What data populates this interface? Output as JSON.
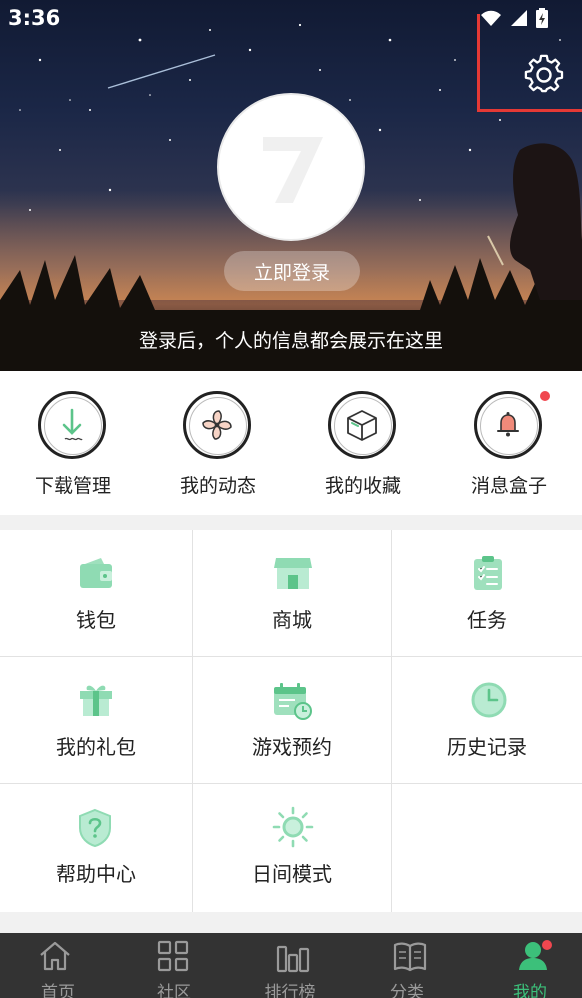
{
  "status_bar": {
    "time": "3:36"
  },
  "profile": {
    "login_button": "立即登录",
    "login_hint": "登录后，个人的信息都会展示在这里"
  },
  "quick_actions": [
    {
      "label": "下载管理",
      "icon": "download-icon"
    },
    {
      "label": "我的动态",
      "icon": "fan-icon"
    },
    {
      "label": "我的收藏",
      "icon": "box-icon"
    },
    {
      "label": "消息盒子",
      "icon": "bell-icon",
      "has_badge": true
    }
  ],
  "menu": [
    {
      "label": "钱包",
      "icon": "wallet-icon"
    },
    {
      "label": "商城",
      "icon": "store-icon"
    },
    {
      "label": "任务",
      "icon": "task-list-icon"
    },
    {
      "label": "我的礼包",
      "icon": "gift-icon"
    },
    {
      "label": "游戏预约",
      "icon": "calendar-icon"
    },
    {
      "label": "历史记录",
      "icon": "clock-icon"
    },
    {
      "label": "帮助中心",
      "icon": "help-shield-icon"
    },
    {
      "label": "日间模式",
      "icon": "sun-icon"
    }
  ],
  "tabbar": [
    {
      "label": "首页",
      "icon": "home-icon"
    },
    {
      "label": "社区",
      "icon": "grid-icon"
    },
    {
      "label": "排行榜",
      "icon": "ranking-icon"
    },
    {
      "label": "分类",
      "icon": "book-icon"
    },
    {
      "label": "我的",
      "icon": "user-icon",
      "active": true
    }
  ],
  "colors": {
    "accent": "#3cc07a",
    "icon_green": "#7fd6a8",
    "badge": "#f0474f",
    "tabbar_bg": "#333333",
    "highlight_box": "#e53935"
  }
}
